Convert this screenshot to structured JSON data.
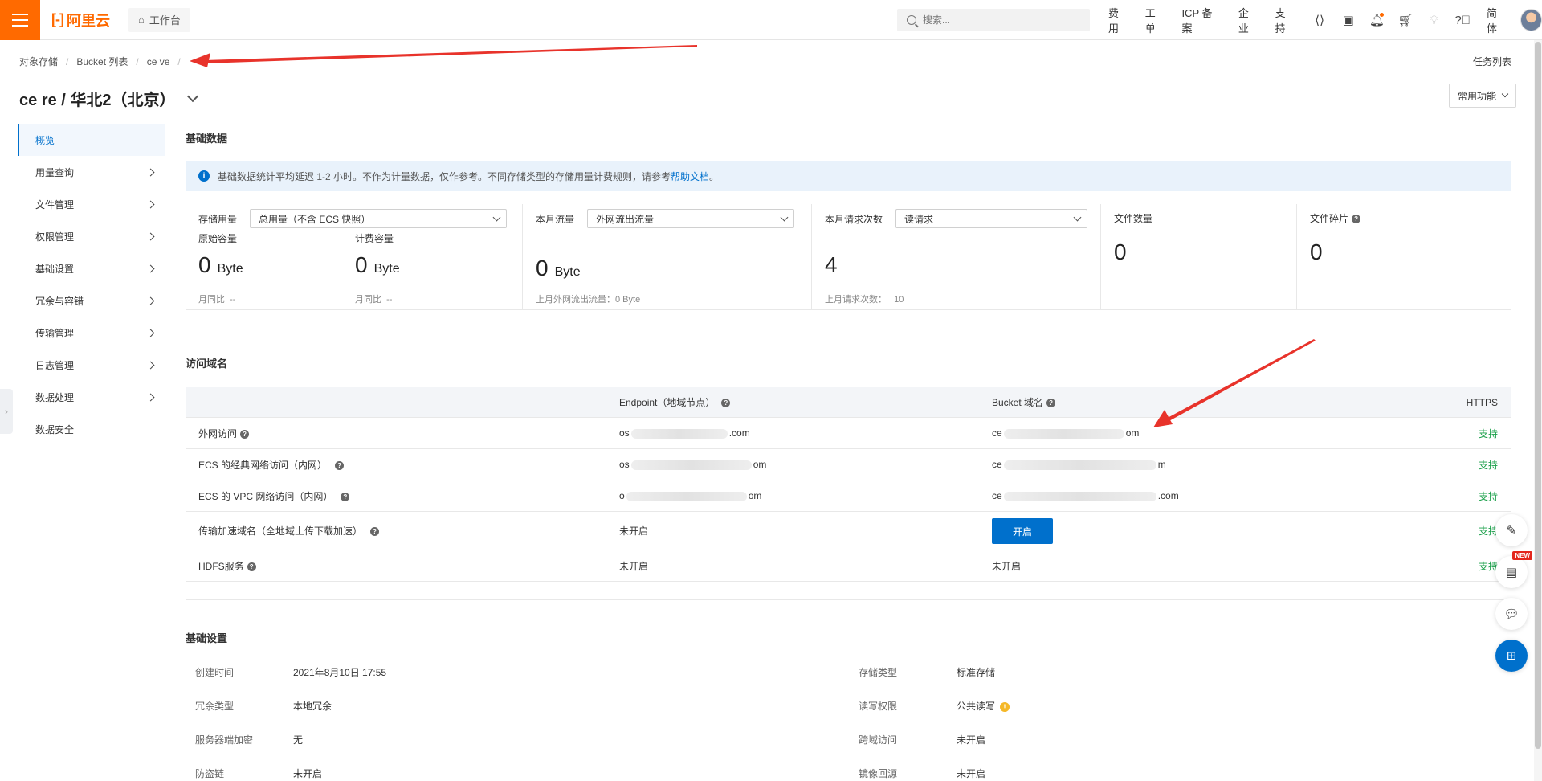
{
  "topbar": {
    "logo_text": "阿里云",
    "workbench_label": "工作台",
    "search_placeholder": "搜索...",
    "links": [
      "费用",
      "工单",
      "ICP 备案",
      "企业",
      "支持"
    ],
    "lang": "简体",
    "brand_color": "#ff6a00"
  },
  "breadcrumb": {
    "items": [
      "对象存储",
      "Bucket 列表",
      "ce   ve"
    ],
    "task_list": "任务列表"
  },
  "header": {
    "title": "ce    re / 华北2（北京）",
    "common_functions": "常用功能"
  },
  "sidebar": {
    "items": [
      {
        "label": "概览",
        "active": true,
        "has_arrow": false
      },
      {
        "label": "用量查询",
        "has_arrow": true
      },
      {
        "label": "文件管理",
        "has_arrow": true
      },
      {
        "label": "权限管理",
        "has_arrow": true
      },
      {
        "label": "基础设置",
        "has_arrow": true
      },
      {
        "label": "冗余与容错",
        "has_arrow": true
      },
      {
        "label": "传输管理",
        "has_arrow": true
      },
      {
        "label": "日志管理",
        "has_arrow": true
      },
      {
        "label": "数据处理",
        "has_arrow": true
      },
      {
        "label": "数据安全",
        "has_arrow": false
      }
    ]
  },
  "basic_data": {
    "title": "基础数据",
    "notice_text": "基础数据统计平均延迟 1-2 小时。不作为计量数据，仅作参考。不同存储类型的存储用量计费规则，请参考",
    "notice_link": "帮助文档",
    "notice_tail": "。",
    "storage": {
      "label": "存储用量",
      "select_value": "总用量（不含 ECS 快照）",
      "raw_label": "原始容量",
      "raw_value": "0",
      "raw_unit": "Byte",
      "billed_label": "计费容量",
      "billed_value": "0",
      "billed_unit": "Byte",
      "mom_label": "月同比",
      "mom_value": "--"
    },
    "traffic": {
      "label": "本月流量",
      "select_value": "外网流出流量",
      "value": "0",
      "unit": "Byte",
      "last_month": "上月外网流出流量：0 Byte"
    },
    "requests": {
      "label": "本月请求次数",
      "select_value": "读请求",
      "value": "4",
      "last_month_label": "上月请求次数：",
      "last_month_value": "10"
    },
    "file_count": {
      "label": "文件数量",
      "value": "0"
    },
    "fragments": {
      "label": "文件碎片",
      "value": "0"
    }
  },
  "domains": {
    "title": "访问域名",
    "headers": {
      "endpoint": "Endpoint（地域节点）",
      "bucket": "Bucket 域名",
      "https": "HTTPS"
    },
    "rows": [
      {
        "name": "外网访问",
        "endpoint_pre": "os",
        "endpoint_post": ".com",
        "bucket_pre": "ce",
        "bucket_post": "om",
        "https": "支持"
      },
      {
        "name": "ECS 的经典网络访问（内网）",
        "endpoint_pre": "os",
        "endpoint_post": "om",
        "bucket_pre": "ce",
        "bucket_post": "m",
        "https": "支持"
      },
      {
        "name": "ECS 的 VPC 网络访问（内网）",
        "endpoint_pre": "o",
        "endpoint_post": "om",
        "bucket_pre": "ce",
        "bucket_post": ".com",
        "https": "支持"
      },
      {
        "name": "传输加速域名（全地域上传下载加速）",
        "endpoint_text": "未开启",
        "button": "开启",
        "https": "支持"
      },
      {
        "name": "HDFS服务",
        "endpoint_text": "未开启",
        "bucket_text": "未开启",
        "https": "支持"
      }
    ]
  },
  "settings": {
    "title": "基础设置",
    "left": [
      {
        "k": "创建时间",
        "v": "2021年8月10日 17:55"
      },
      {
        "k": "冗余类型",
        "v": "本地冗余"
      },
      {
        "k": "服务器端加密",
        "v": "无"
      },
      {
        "k": "防盗链",
        "v": "未开启"
      }
    ],
    "right": [
      {
        "k": "存储类型",
        "v": "标准存储"
      },
      {
        "k": "读写权限",
        "v": "公共读写"
      },
      {
        "k": "跨域访问",
        "v": "未开启"
      },
      {
        "k": "镜像回源",
        "v": "未开启"
      }
    ]
  },
  "float_tools": {
    "new_badge": "NEW"
  }
}
